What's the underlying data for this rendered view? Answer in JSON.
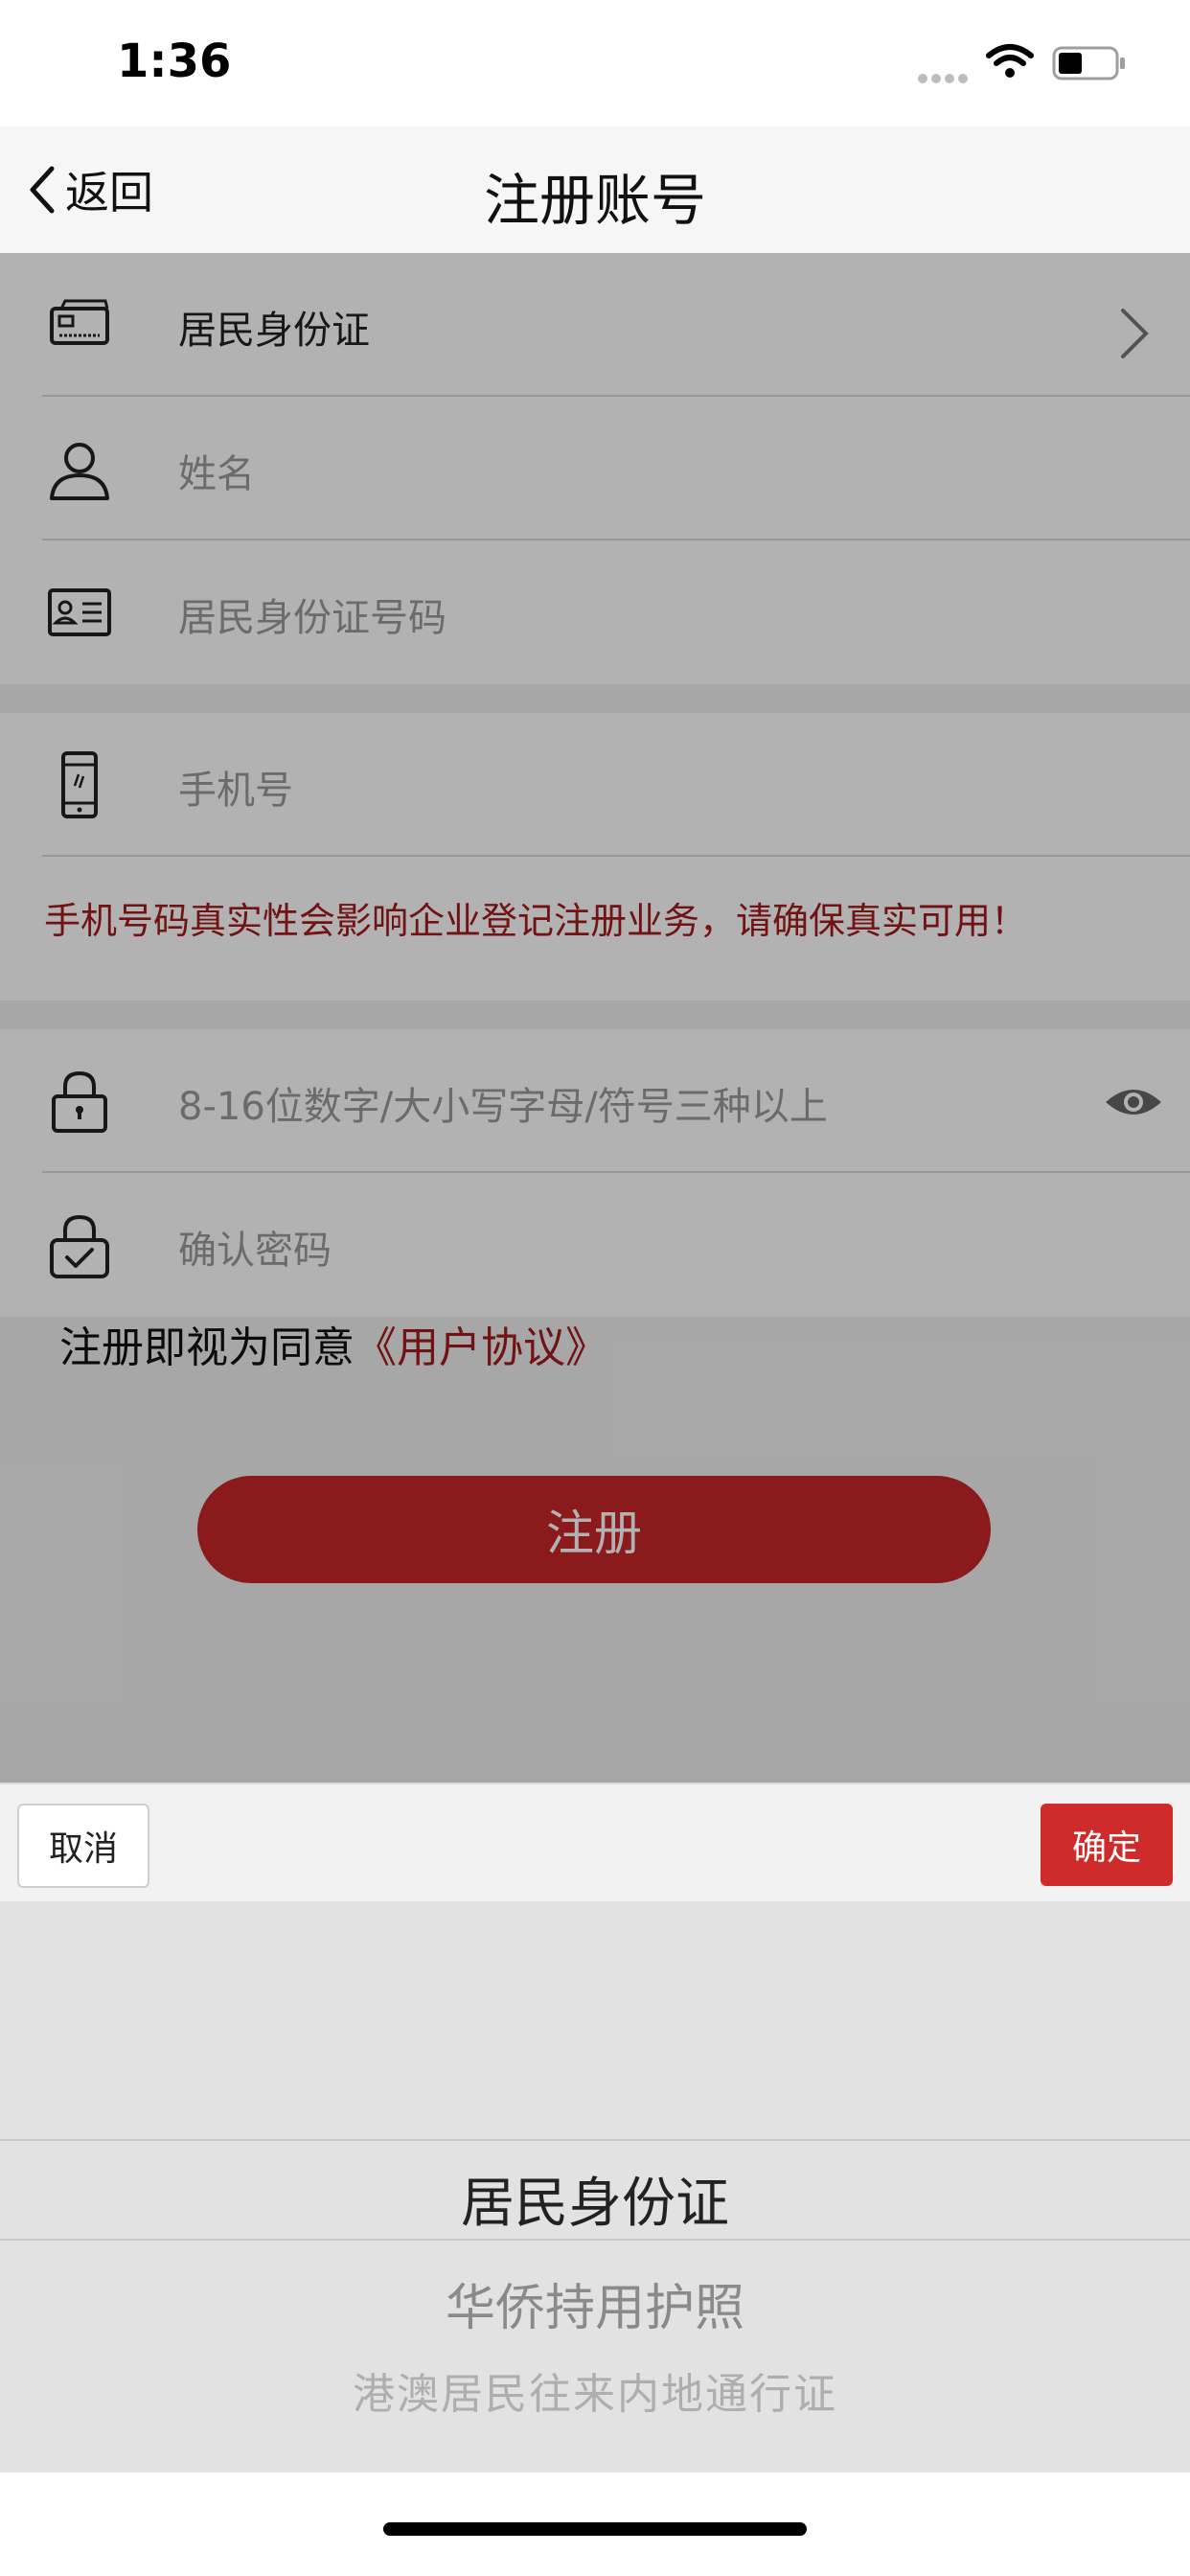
{
  "status_bar": {
    "time": "1:36"
  },
  "nav": {
    "back_label": "返回",
    "title": "注册账号"
  },
  "form": {
    "id_type_value": "居民身份证",
    "name_placeholder": "姓名",
    "id_number_placeholder": "居民身份证号码",
    "phone_placeholder": "手机号",
    "phone_warning": "手机号码真实性会影响企业登记注册业务，请确保真实可用！",
    "password_placeholder": "8-16位数字/大小写字母/符号三种以上",
    "confirm_password_placeholder": "确认密码"
  },
  "agreement": {
    "prefix": "注册即视为同意",
    "link": "《用户协议》"
  },
  "register_button": "注册",
  "picker": {
    "cancel_label": "取消",
    "confirm_label": "确定",
    "options": [
      "居民身份证",
      "华侨持用护照",
      "港澳居民往来内地通行证"
    ],
    "selected_index": 0
  },
  "colors": {
    "accent": "#c8262a",
    "warning_text": "#a31c1c",
    "confirm_button": "#d02b2b"
  }
}
